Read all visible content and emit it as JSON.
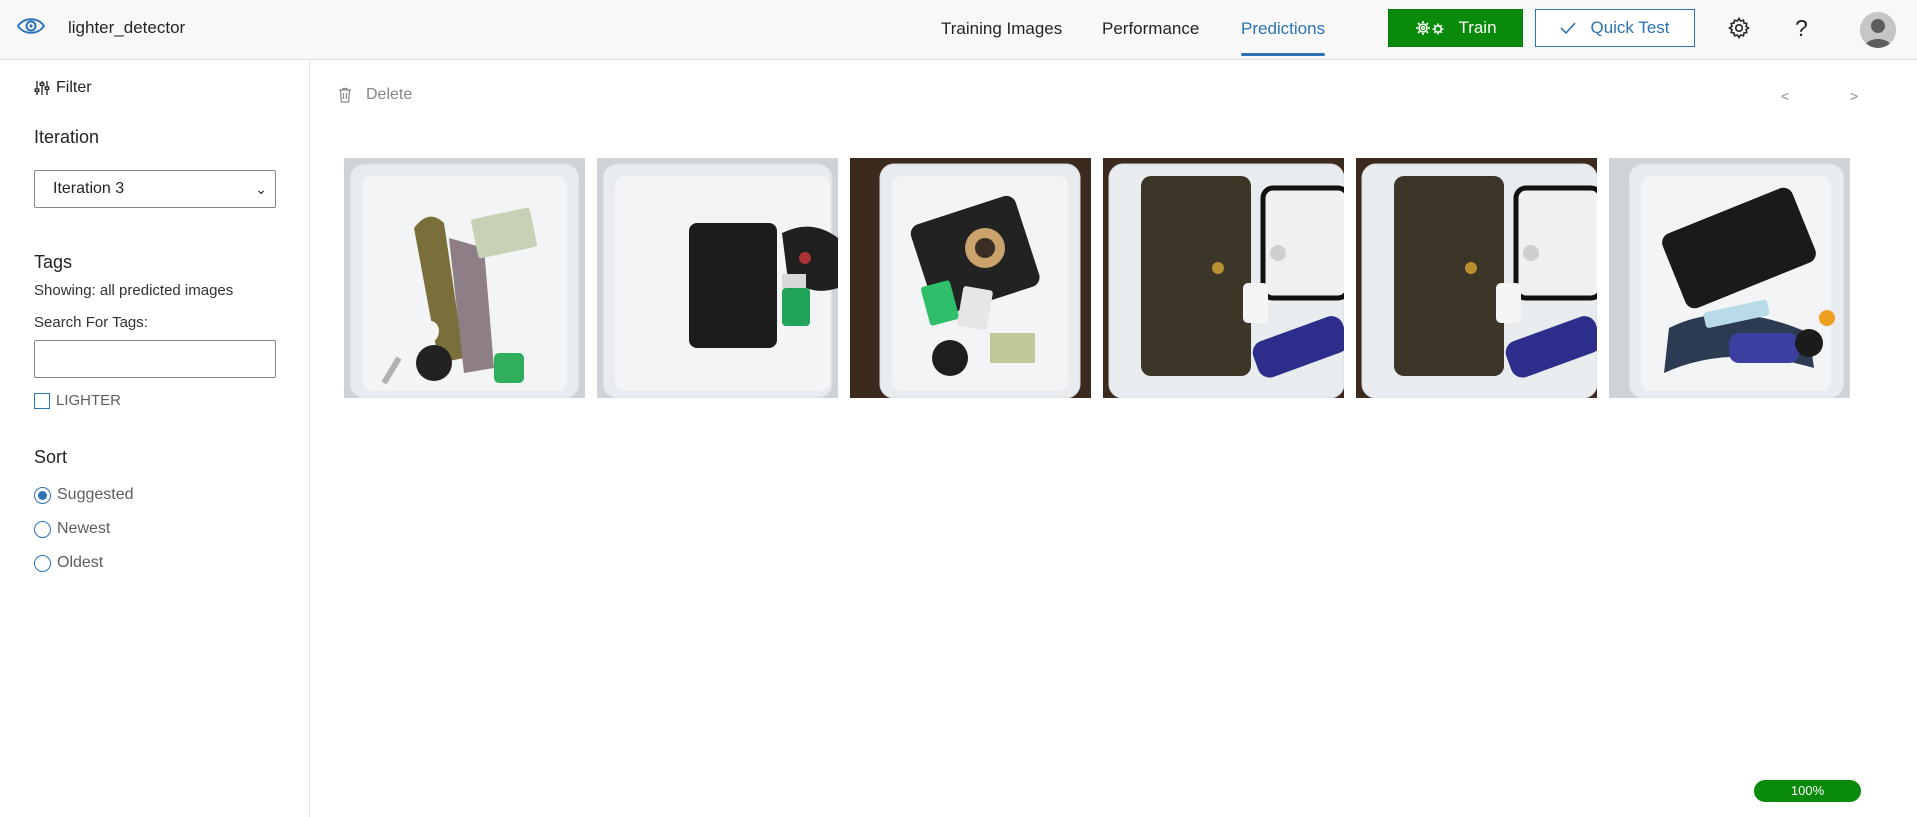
{
  "header": {
    "project_name": "lighter_detector",
    "tabs": [
      {
        "label": "Training Images"
      },
      {
        "label": "Performance"
      },
      {
        "label": "Predictions",
        "active": true
      }
    ],
    "train_label": "Train",
    "quick_test_label": "Quick Test",
    "help_label": "?",
    "icons": [
      "eye-icon",
      "gears-icon",
      "checkmark-icon",
      "settings-gear-icon",
      "help-icon",
      "user-avatar"
    ]
  },
  "sidebar": {
    "filter_label": "Filter",
    "iteration_heading": "Iteration",
    "iteration_selected": "Iteration 3",
    "tags_heading": "Tags",
    "showing_text": "Showing: all predicted images",
    "search_label": "Search For Tags:",
    "search_value": "",
    "tag_options": [
      {
        "label": "LIGHTER",
        "checked": false
      }
    ],
    "sort_heading": "Sort",
    "sort_options": [
      {
        "label": "Suggested",
        "selected": true
      },
      {
        "label": "Newest",
        "selected": false
      },
      {
        "label": "Oldest",
        "selected": false
      }
    ]
  },
  "toolbar": {
    "delete_label": "Delete",
    "prev_label": "<",
    "next_label": ">"
  },
  "images": [
    {
      "name": "prediction-image-1",
      "content": "keys, wristlet strap, dollar bill, lighter in white tray"
    },
    {
      "name": "prediction-image-2",
      "content": "black wallet, car key fob, green lighter in white tray"
    },
    {
      "name": "prediction-image-3",
      "content": "phone, tape, lighters, keys, cash in white tray"
    },
    {
      "name": "prediction-image-4",
      "content": "patterned wallet, phone, lighter, spray bottle in white tray"
    },
    {
      "name": "prediction-image-5",
      "content": "patterned wallet, phone, lighter, spray bottle in white tray"
    },
    {
      "name": "prediction-image-6",
      "content": "phone, lanyard, lighter, spray bottle in white tray"
    }
  ],
  "status": {
    "progress_text": "100%",
    "progress_fraction": 1.0
  },
  "colors": {
    "accent": "#2b73b6",
    "train_green": "#0a8a0a",
    "tray_white": "#e9ecef",
    "table_brown": "#3d2a1e"
  }
}
